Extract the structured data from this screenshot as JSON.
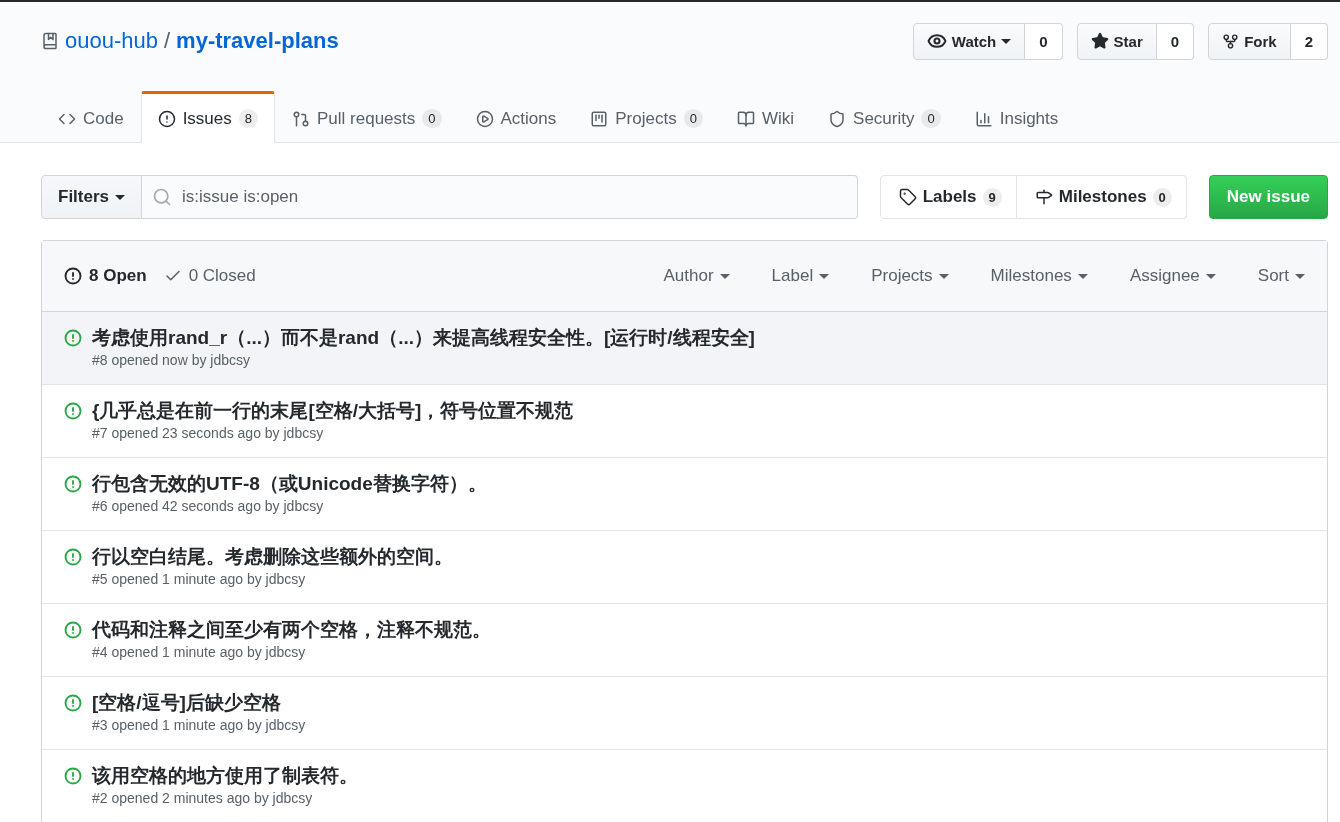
{
  "repo": {
    "owner": "ouou-hub",
    "separator": "/",
    "name": "my-travel-plans"
  },
  "actions": [
    {
      "kind": "watch",
      "label": "Watch",
      "dropdown": true,
      "count": "0"
    },
    {
      "kind": "star",
      "label": "Star",
      "dropdown": false,
      "count": "0"
    },
    {
      "kind": "fork",
      "label": "Fork",
      "dropdown": false,
      "count": "2"
    }
  ],
  "tabs": [
    {
      "kind": "code",
      "label": "Code",
      "selected": false
    },
    {
      "kind": "issues",
      "label": "Issues",
      "counter": "8",
      "selected": true
    },
    {
      "kind": "pulls",
      "label": "Pull requests",
      "counter": "0",
      "selected": false
    },
    {
      "kind": "actions",
      "label": "Actions",
      "selected": false
    },
    {
      "kind": "projects",
      "label": "Projects",
      "counter": "0",
      "selected": false
    },
    {
      "kind": "wiki",
      "label": "Wiki",
      "selected": false
    },
    {
      "kind": "security",
      "label": "Security",
      "counter": "0",
      "selected": false
    },
    {
      "kind": "insights",
      "label": "Insights",
      "selected": false
    }
  ],
  "filters": {
    "button": "Filters",
    "query": "is:issue is:open"
  },
  "nav_links": [
    {
      "kind": "labels",
      "label": "Labels",
      "count": "9"
    },
    {
      "kind": "milestones",
      "label": "Milestones",
      "count": "0"
    }
  ],
  "new_issue": "New issue",
  "states": [
    {
      "kind": "open",
      "label": "8 Open",
      "selected": true
    },
    {
      "kind": "closed",
      "label": "0 Closed",
      "selected": false
    }
  ],
  "sort_menus": [
    "Author",
    "Label",
    "Projects",
    "Milestones",
    "Assignee",
    "Sort"
  ],
  "issues": [
    {
      "title": "考虑使用rand_r（...）而不是rand（...）来提高线程安全性。[运行时/线程安全]",
      "meta": "#8 opened now by jdbcsy",
      "highlighted": true
    },
    {
      "title": "{几乎总是在前一行的末尾[空格/大括号]，符号位置不规范",
      "meta": "#7 opened 23 seconds ago by jdbcsy",
      "highlighted": false
    },
    {
      "title": "行包含无效的UTF-8（或Unicode替换字符）。",
      "meta": "#6 opened 42 seconds ago by jdbcsy",
      "highlighted": false
    },
    {
      "title": "行以空白结尾。考虑删除这些额外的空间。",
      "meta": "#5 opened 1 minute ago by jdbcsy",
      "highlighted": false
    },
    {
      "title": "代码和注释之间至少有两个空格，注释不规范。",
      "meta": "#4 opened 1 minute ago by jdbcsy",
      "highlighted": false
    },
    {
      "title": "[空格/逗号]后缺少空格",
      "meta": "#3 opened 1 minute ago by jdbcsy",
      "highlighted": false
    },
    {
      "title": "该用空格的地方使用了制表符。",
      "meta": "#2 opened 2 minutes ago by jdbcsy",
      "highlighted": false
    }
  ]
}
